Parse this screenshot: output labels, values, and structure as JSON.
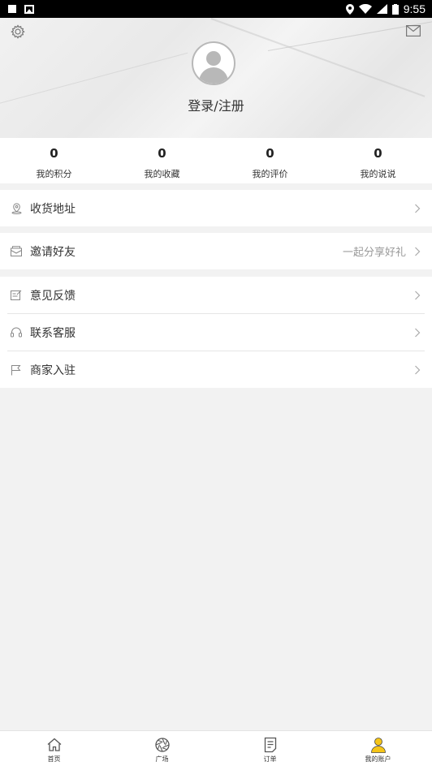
{
  "status_bar": {
    "time": "9:55"
  },
  "header": {
    "login_text": "登录/注册"
  },
  "stats": [
    {
      "value": "0",
      "label": "我的积分"
    },
    {
      "value": "0",
      "label": "我的收藏"
    },
    {
      "value": "0",
      "label": "我的评价"
    },
    {
      "value": "0",
      "label": "我的说说"
    }
  ],
  "menu": {
    "address": {
      "label": "收货地址",
      "icon": "location-pin-icon"
    },
    "invite": {
      "label": "邀请好友",
      "hint": "一起分享好礼",
      "icon": "envelope-icon"
    },
    "feedback": {
      "label": "意见反馈",
      "icon": "edit-note-icon"
    },
    "support": {
      "label": "联系客服",
      "icon": "headset-icon"
    },
    "merchant": {
      "label": "商家入驻",
      "icon": "flag-icon"
    }
  },
  "tabbar": {
    "items": [
      {
        "label": "首页",
        "icon": "home-icon"
      },
      {
        "label": "广场",
        "icon": "aperture-icon"
      },
      {
        "label": "订单",
        "icon": "order-doc-icon"
      },
      {
        "label": "我的账户",
        "icon": "user-icon",
        "active": true
      }
    ],
    "active_color": "#f5c518"
  }
}
